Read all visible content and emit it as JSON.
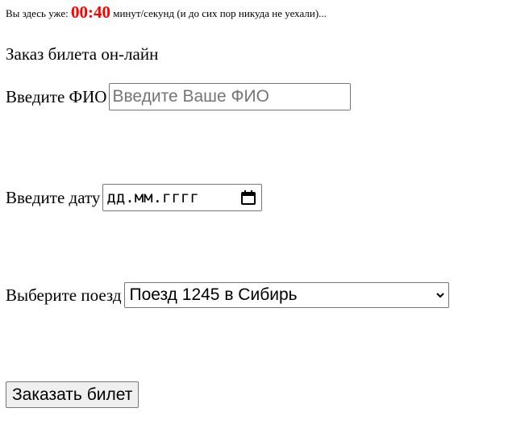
{
  "timer": {
    "prefix": "Вы здесь уже:",
    "value": "00:40",
    "suffix": "минут/секунд (и до сих пор никуда не уехали)...",
    "value_color": "#ff0000"
  },
  "page_title": "Заказ билета он-лайн",
  "form": {
    "name_label": "Введите ФИО",
    "name_placeholder": "Введите Ваше ФИО",
    "name_value": "",
    "date_label": "Введите дату",
    "date_placeholder": "дд.мм.гггг",
    "date_icon": "calendar-icon",
    "train_label": "Выберите поезд",
    "train_selected": "Поезд 1245 в Сибирь",
    "train_icon": "chevron-down-icon",
    "submit_label": "Заказать билет"
  }
}
